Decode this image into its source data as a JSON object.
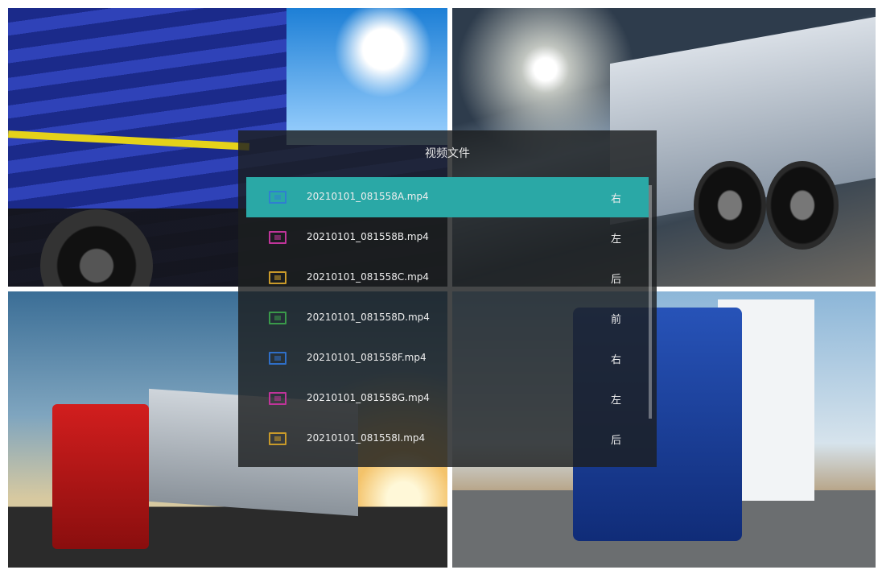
{
  "dialog": {
    "title": "视频文件",
    "files": [
      {
        "name": "20210101_081558A.mp4",
        "position": "右",
        "icon": "video-file-icon",
        "icon_color": "#2f7fd0",
        "selected": true
      },
      {
        "name": "20210101_081558B.mp4",
        "position": "左",
        "icon": "video-file-icon",
        "icon_color": "#c0349a",
        "selected": false
      },
      {
        "name": "20210101_081558C.mp4",
        "position": "后",
        "icon": "video-file-icon",
        "icon_color": "#c99a2a",
        "selected": false
      },
      {
        "name": "20210101_081558D.mp4",
        "position": "前",
        "icon": "video-file-icon",
        "icon_color": "#3a9a4a",
        "selected": false
      },
      {
        "name": "20210101_081558F.mp4",
        "position": "右",
        "icon": "video-file-icon",
        "icon_color": "#2f6fc8",
        "selected": false
      },
      {
        "name": "20210101_081558G.mp4",
        "position": "左",
        "icon": "video-file-icon",
        "icon_color": "#c0349a",
        "selected": false
      },
      {
        "name": "20210101_081558I.mp4",
        "position": "后",
        "icon": "video-file-icon",
        "icon_color": "#c99a2a",
        "selected": false
      }
    ]
  },
  "colors": {
    "selected_row": "#2aa8a6",
    "dialog_bg": "rgba(28,30,32,0.82)"
  }
}
